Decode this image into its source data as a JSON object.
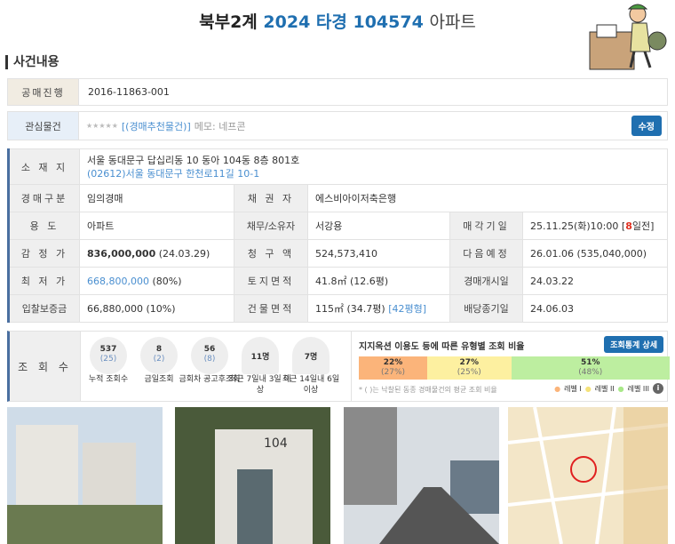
{
  "header": {
    "part1": "북부2계",
    "part2": "2024 타경 104574",
    "part3": "아파트"
  },
  "section_title": "사건내용",
  "public_sale": {
    "label": "공매진행",
    "value": "2016-11863-001"
  },
  "interest": {
    "label": "관심물건",
    "stars": "★★★★★",
    "tag": "[(경매추천물건)]",
    "memo": "메모: 네프콘",
    "edit": "수정"
  },
  "details": {
    "address_label": "소 재 지",
    "address": "서울 동대문구 답십리동 10 동아 104동 8층 801호",
    "road_address": "(02612)서울 동대문구 한천로11길 10-1",
    "rows": [
      {
        "l1": "경매구분",
        "v1": "임의경매",
        "l2": "채 권 자",
        "v2": "에스비아이저축은행"
      },
      {
        "l1": "용 도",
        "v1": "아파트",
        "l2": "채무/소유자",
        "v2": "서강용",
        "l3": "매각기일",
        "v3": "25.11.25(화)10:00 [",
        "v3b": "8",
        "v3c": "일전]"
      },
      {
        "l1": "감 정 가",
        "v1": "836,000,000",
        "v1b": " (24.03.29)",
        "l2": "청 구 액",
        "v2": "524,573,410",
        "l3": "다음예정",
        "v3": "26.01.06 (535,040,000)"
      },
      {
        "l1": "최 저 가",
        "v1": "668,800,000",
        "v1b": " (80%)",
        "l2": "토지면적",
        "v2": "41.8㎡ (12.6평)",
        "l3": "경매개시일",
        "v3": "24.03.22"
      },
      {
        "l1": "입찰보증금",
        "v1": "66,880,000 (10%)",
        "l2": "건물면적",
        "v2": "115㎡ (34.7평) ",
        "v2b": "[42평형]",
        "l3": "배당종기일",
        "v3": "24.06.03"
      }
    ]
  },
  "views": {
    "label": "조 회 수",
    "stats": [
      {
        "value": "537",
        "sub": "(25)",
        "caption": "누적 조회수"
      },
      {
        "value": "8",
        "sub": "(2)",
        "caption": "금일조회"
      },
      {
        "value": "56",
        "sub": "(8)",
        "caption": "금회차 공고후조회"
      },
      {
        "value": "11명",
        "caption": "최근 7일내 3일 이상"
      },
      {
        "value": "7명",
        "caption": "최근 14일내 6일 이상"
      }
    ],
    "ratio_title": "지지옥션 이용도 등에 따른 유형별 조회 비율",
    "detail_btn": "조회통계 상세",
    "ratios": [
      {
        "pct": "22%",
        "avg": "(27%)",
        "color": "#fbb47a",
        "share": 22
      },
      {
        "pct": "27%",
        "avg": "(25%)",
        "color": "#fdf0a0",
        "share": 27
      },
      {
        "pct": "51%",
        "avg": "(48%)",
        "color": "#bdeea0",
        "share": 51
      }
    ],
    "note": "* ( )는 낙찰된 동종 경매물건의 평균 조회 비율",
    "legend": [
      "레벨 I",
      "레벨 II",
      "레벨 III"
    ]
  },
  "colors": {
    "accent": "#1f6fb0",
    "link": "#4a8fd0",
    "warn": "#e03020"
  }
}
